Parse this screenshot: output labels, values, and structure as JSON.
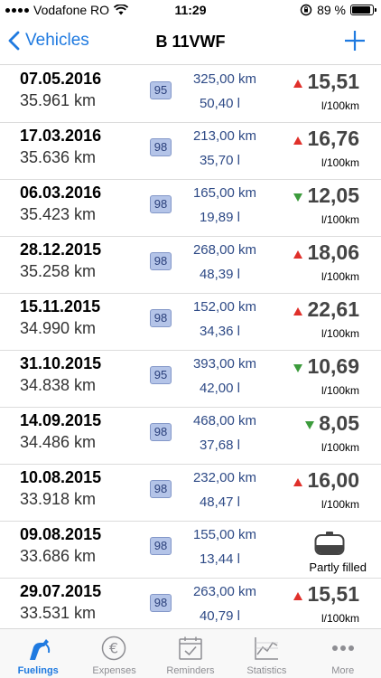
{
  "status_bar": {
    "carrier": "Vodafone RO",
    "time": "11:29",
    "battery_text": "89 %",
    "battery_level": 0.89
  },
  "nav": {
    "back_label": "Vehicles",
    "title": "B 11VWF",
    "add_icon": "plus-icon"
  },
  "fuelings": [
    {
      "date": "07.05.2016",
      "odometer": "35.961 km",
      "fuel": "95",
      "distance": "325,00 km",
      "volume": "50,40 l",
      "trend": "up",
      "consumption": "15,51",
      "unit": "l/100km"
    },
    {
      "date": "17.03.2016",
      "odometer": "35.636 km",
      "fuel": "98",
      "distance": "213,00 km",
      "volume": "35,70 l",
      "trend": "up",
      "consumption": "16,76",
      "unit": "l/100km"
    },
    {
      "date": "06.03.2016",
      "odometer": "35.423 km",
      "fuel": "98",
      "distance": "165,00 km",
      "volume": "19,89 l",
      "trend": "down",
      "consumption": "12,05",
      "unit": "l/100km"
    },
    {
      "date": "28.12.2015",
      "odometer": "35.258 km",
      "fuel": "98",
      "distance": "268,00 km",
      "volume": "48,39 l",
      "trend": "up",
      "consumption": "18,06",
      "unit": "l/100km"
    },
    {
      "date": "15.11.2015",
      "odometer": "34.990 km",
      "fuel": "98",
      "distance": "152,00 km",
      "volume": "34,36 l",
      "trend": "up",
      "consumption": "22,61",
      "unit": "l/100km"
    },
    {
      "date": "31.10.2015",
      "odometer": "34.838 km",
      "fuel": "95",
      "distance": "393,00 km",
      "volume": "42,00 l",
      "trend": "down",
      "consumption": "10,69",
      "unit": "l/100km"
    },
    {
      "date": "14.09.2015",
      "odometer": "34.486 km",
      "fuel": "98",
      "distance": "468,00 km",
      "volume": "37,68 l",
      "trend": "down",
      "consumption": "8,05",
      "unit": "l/100km"
    },
    {
      "date": "10.08.2015",
      "odometer": "33.918 km",
      "fuel": "98",
      "distance": "232,00 km",
      "volume": "48,47 l",
      "trend": "up",
      "consumption": "16,00",
      "unit": "l/100km"
    },
    {
      "date": "09.08.2015",
      "odometer": "33.686 km",
      "fuel": "98",
      "distance": "155,00 km",
      "volume": "13,44 l",
      "trend": "none",
      "partly_filled": "Partly filled"
    },
    {
      "date": "29.07.2015",
      "odometer": "33.531 km",
      "fuel": "98",
      "distance": "263,00 km",
      "volume": "40,79 l",
      "trend": "up",
      "consumption": "15,51",
      "unit": "l/100km"
    }
  ],
  "tabs": [
    {
      "label": "Fuelings",
      "icon": "fuel-pump-icon",
      "active": true
    },
    {
      "label": "Expenses",
      "icon": "euro-icon",
      "active": false
    },
    {
      "label": "Reminders",
      "icon": "calendar-check-icon",
      "active": false
    },
    {
      "label": "Statistics",
      "icon": "line-chart-icon",
      "active": false
    },
    {
      "label": "More",
      "icon": "more-dots-icon",
      "active": false
    }
  ],
  "colors": {
    "accent": "#1f7ae0",
    "trend_up": "#e0302a",
    "trend_down": "#3c9b3c",
    "badge_bg": "#b4c4e8",
    "value_text": "#2e4a86"
  }
}
